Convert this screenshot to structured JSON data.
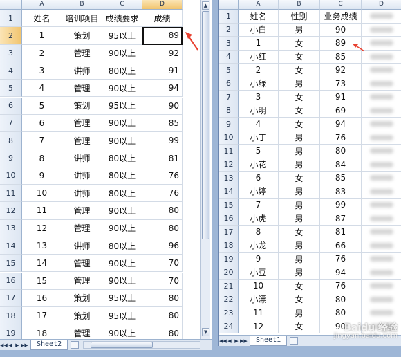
{
  "left_sheet": {
    "columns": [
      "A",
      "B",
      "C",
      "D"
    ],
    "active_column": "D",
    "active_row": "2",
    "rows": [
      {
        "n": "1",
        "a": "姓名",
        "b": "培训项目",
        "c": "成绩要求",
        "d": "成绩"
      },
      {
        "n": "2",
        "a": "1",
        "b": "策划",
        "c": "95以上",
        "d": "89"
      },
      {
        "n": "3",
        "a": "2",
        "b": "管理",
        "c": "90以上",
        "d": "92"
      },
      {
        "n": "4",
        "a": "3",
        "b": "讲师",
        "c": "80以上",
        "d": "91"
      },
      {
        "n": "5",
        "a": "4",
        "b": "管理",
        "c": "90以上",
        "d": "94"
      },
      {
        "n": "6",
        "a": "5",
        "b": "策划",
        "c": "95以上",
        "d": "90"
      },
      {
        "n": "7",
        "a": "6",
        "b": "管理",
        "c": "90以上",
        "d": "85"
      },
      {
        "n": "8",
        "a": "7",
        "b": "管理",
        "c": "90以上",
        "d": "99"
      },
      {
        "n": "9",
        "a": "8",
        "b": "讲师",
        "c": "80以上",
        "d": "81"
      },
      {
        "n": "10",
        "a": "9",
        "b": "讲师",
        "c": "80以上",
        "d": "76"
      },
      {
        "n": "11",
        "a": "10",
        "b": "讲师",
        "c": "80以上",
        "d": "76"
      },
      {
        "n": "12",
        "a": "11",
        "b": "管理",
        "c": "90以上",
        "d": "80"
      },
      {
        "n": "13",
        "a": "12",
        "b": "管理",
        "c": "90以上",
        "d": "80"
      },
      {
        "n": "14",
        "a": "13",
        "b": "讲师",
        "c": "80以上",
        "d": "96"
      },
      {
        "n": "15",
        "a": "14",
        "b": "管理",
        "c": "90以上",
        "d": "70"
      },
      {
        "n": "16",
        "a": "15",
        "b": "管理",
        "c": "90以上",
        "d": "70"
      },
      {
        "n": "17",
        "a": "16",
        "b": "策划",
        "c": "95以上",
        "d": "80"
      },
      {
        "n": "18",
        "a": "17",
        "b": "策划",
        "c": "95以上",
        "d": "80"
      },
      {
        "n": "19",
        "a": "18",
        "b": "管理",
        "c": "90以上",
        "d": "80"
      }
    ],
    "sheet_tab": "Sheet2",
    "nav_buttons": [
      "◀◀",
      "◀",
      "▶",
      "▶▶"
    ]
  },
  "right_sheet": {
    "columns": [
      "A",
      "B",
      "C",
      "D"
    ],
    "rows": [
      {
        "n": "1",
        "a": "姓名",
        "b": "性别",
        "c": "业务成绩",
        "d": ""
      },
      {
        "n": "2",
        "a": "小白",
        "b": "男",
        "c": "90",
        "d": ""
      },
      {
        "n": "3",
        "a": "1",
        "b": "女",
        "c": "89",
        "d": ""
      },
      {
        "n": "4",
        "a": "小红",
        "b": "女",
        "c": "85",
        "d": ""
      },
      {
        "n": "5",
        "a": "2",
        "b": "女",
        "c": "92",
        "d": ""
      },
      {
        "n": "6",
        "a": "小绿",
        "b": "男",
        "c": "73",
        "d": ""
      },
      {
        "n": "7",
        "a": "3",
        "b": "女",
        "c": "91",
        "d": ""
      },
      {
        "n": "8",
        "a": "小明",
        "b": "女",
        "c": "69",
        "d": ""
      },
      {
        "n": "9",
        "a": "4",
        "b": "女",
        "c": "94",
        "d": ""
      },
      {
        "n": "10",
        "a": "小丁",
        "b": "男",
        "c": "76",
        "d": ""
      },
      {
        "n": "11",
        "a": "5",
        "b": "男",
        "c": "80",
        "d": ""
      },
      {
        "n": "12",
        "a": "小花",
        "b": "男",
        "c": "84",
        "d": ""
      },
      {
        "n": "13",
        "a": "6",
        "b": "女",
        "c": "85",
        "d": ""
      },
      {
        "n": "14",
        "a": "小婷",
        "b": "男",
        "c": "83",
        "d": ""
      },
      {
        "n": "15",
        "a": "7",
        "b": "男",
        "c": "99",
        "d": ""
      },
      {
        "n": "16",
        "a": "小虎",
        "b": "男",
        "c": "87",
        "d": ""
      },
      {
        "n": "17",
        "a": "8",
        "b": "女",
        "c": "81",
        "d": ""
      },
      {
        "n": "18",
        "a": "小龙",
        "b": "男",
        "c": "66",
        "d": ""
      },
      {
        "n": "19",
        "a": "9",
        "b": "男",
        "c": "76",
        "d": ""
      },
      {
        "n": "20",
        "a": "小豆",
        "b": "男",
        "c": "94",
        "d": ""
      },
      {
        "n": "21",
        "a": "10",
        "b": "女",
        "c": "76",
        "d": ""
      },
      {
        "n": "22",
        "a": "小漂",
        "b": "女",
        "c": "80",
        "d": ""
      },
      {
        "n": "23",
        "a": "11",
        "b": "男",
        "c": "80",
        "d": ""
      },
      {
        "n": "24",
        "a": "12",
        "b": "女",
        "c": "90",
        "d": ""
      }
    ],
    "sheet_tab": "Sheet1",
    "nav_buttons": [
      "◀◀",
      "◀",
      "▶",
      "▶▶"
    ]
  },
  "watermark": {
    "main": "Baidu 经验",
    "sub": "jingyan.baidu.com"
  },
  "colors": {
    "arrow": "#e8402f",
    "header_active": "#f1c46e"
  }
}
